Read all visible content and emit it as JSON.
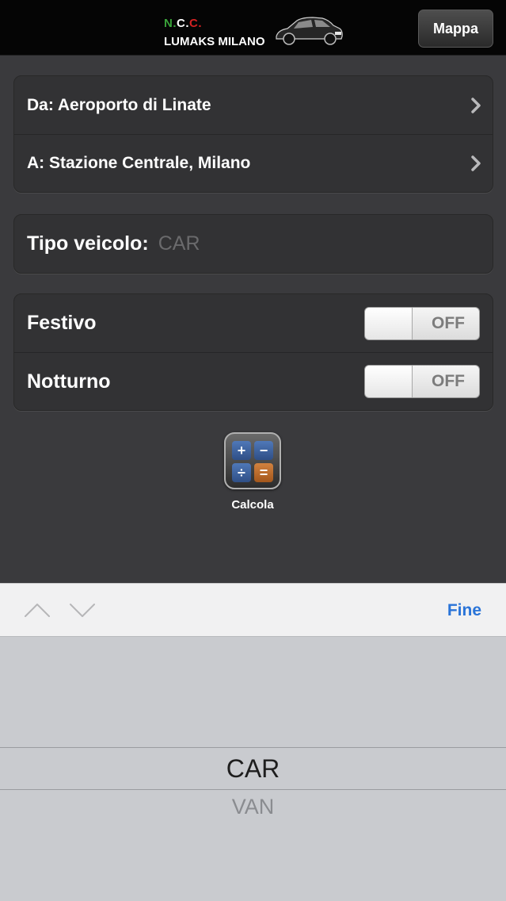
{
  "navbar": {
    "logo": {
      "ncc_n": "N.",
      "ncc_c1": "C.",
      "ncc_c2": "C.",
      "name": "LUMAKS MILANO"
    },
    "map_button_label": "Mappa"
  },
  "route": {
    "from_label": "Da: Aeroporto di Linate",
    "to_label": "A: Stazione Centrale, Milano"
  },
  "vehicle": {
    "label": "Tipo veicolo:",
    "value": "CAR"
  },
  "options": [
    {
      "label": "Festivo",
      "toggle_text": "OFF"
    },
    {
      "label": "Notturno",
      "toggle_text": "OFF"
    }
  ],
  "calculator": {
    "label": "Calcola",
    "keys": [
      "+",
      "−",
      "÷",
      "="
    ],
    "icon": "calculator-icon"
  },
  "toolbar": {
    "done_label": "Fine",
    "prev_icon": "chevron-up-icon",
    "next_icon": "chevron-down-icon"
  },
  "picker": {
    "selected": "CAR",
    "options": [
      "CAR",
      "VAN"
    ]
  },
  "colors": {
    "background": "#3a3a3d",
    "cell": "#323234",
    "accent_blue": "#2a74d8",
    "logo_green": "#3aa33a",
    "logo_red": "#d32222"
  }
}
